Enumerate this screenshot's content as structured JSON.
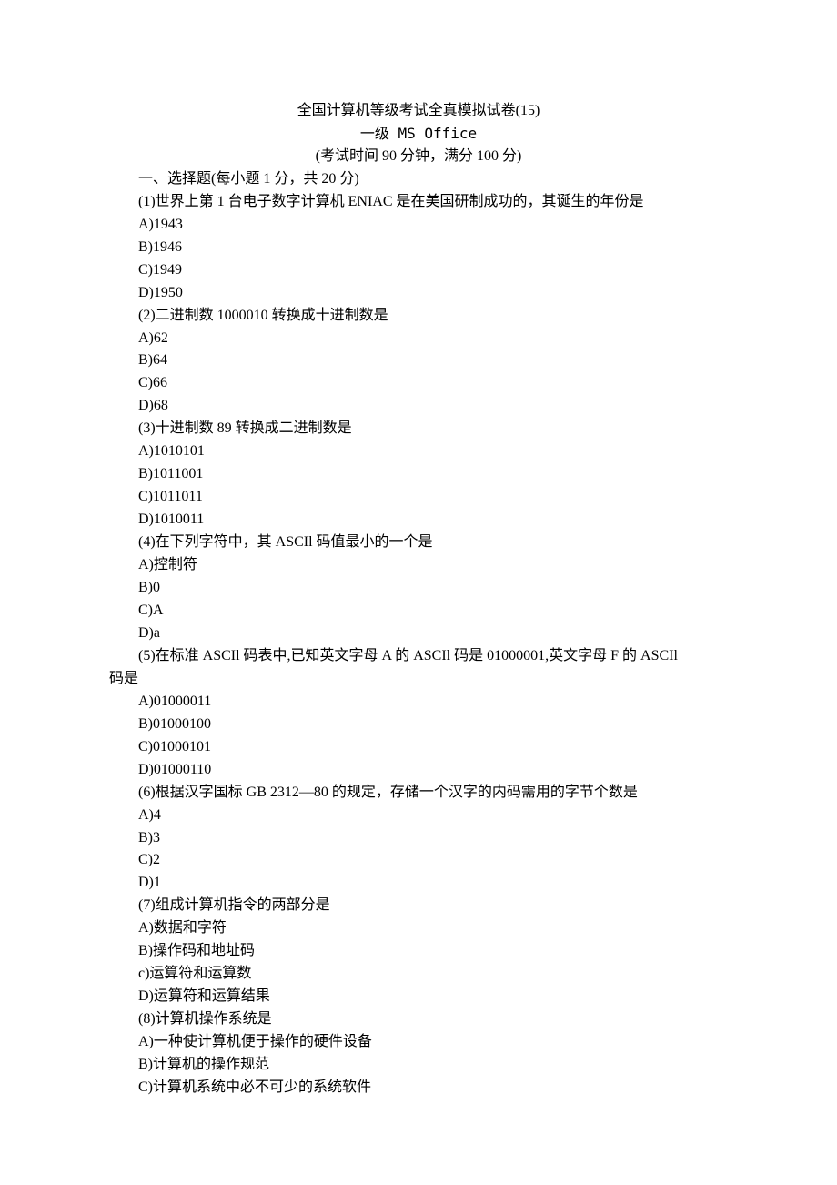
{
  "header": {
    "title": "全国计算机等级考试全真模拟试卷(15)",
    "subtitle": "一级 MS Office",
    "info": "(考试时间 90 分钟，满分 100 分)"
  },
  "section": "一、选择题(每小题 1 分，共 20 分)",
  "items": [
    {
      "prompt": "(1)世界上第 1 台电子数字计算机 ENIAC 是在美国研制成功的，其诞生的年份是",
      "options": [
        "A)1943",
        "B)1946",
        "C)1949",
        "D)1950"
      ]
    },
    {
      "prompt": "(2)二进制数 1000010 转换成十进制数是",
      "options": [
        "A)62",
        "B)64",
        "C)66",
        "D)68"
      ]
    },
    {
      "prompt": "(3)十进制数 89 转换成二进制数是",
      "options": [
        "A)1010101",
        "B)1011001",
        "C)1011011",
        "D)1010011"
      ]
    },
    {
      "prompt": "(4)在下列字符中，其 ASCIl 码值最小的一个是",
      "options": [
        "A)控制符",
        "B)0",
        "C)A",
        "D)a"
      ]
    },
    {
      "prompt_multi": [
        "(5)在标准 ASCIl 码表中,已知英文字母 A 的 ASCIl 码是 01000001,英文字母 F 的 ASCIl",
        "码是"
      ],
      "options": [
        "A)01000011",
        "B)01000100",
        "C)01000101",
        "D)01000110"
      ]
    },
    {
      "prompt": "(6)根据汉字国标 GB 2312—80 的规定，存储一个汉字的内码需用的字节个数是",
      "options": [
        "A)4",
        "B)3",
        "C)2",
        "D)1"
      ]
    },
    {
      "prompt": "(7)组成计算机指令的两部分是",
      "options": [
        "A)数据和字符",
        "B)操作码和地址码",
        "c)运算符和运算数",
        "D)运算符和运算结果"
      ]
    },
    {
      "prompt": "(8)计算机操作系统是",
      "options_partial": [
        "A)一种使计算机便于操作的硬件设备",
        "B)计算机的操作规范",
        "C)计算机系统中必不可少的系统软件"
      ]
    }
  ]
}
